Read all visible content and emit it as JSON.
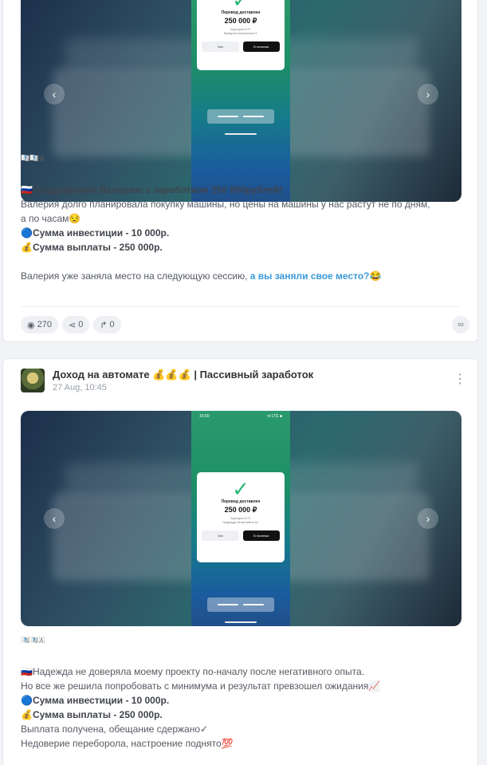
{
  "post1": {
    "flags": "🇦🇦🇦🇦🇦",
    "lines": {
      "l1_prefix": "🇷🇺",
      "l1_bold": "Поздравляем Валерию с заработком 250 000рублей!",
      "l2": "Валерия долго планировала покупку машины, но цены на машины у нас растут не по дням,",
      "l3": "а по часам😒",
      "l4": "🔵Сумма инвестиции - 10 000р.",
      "l5": "💰Сумма выплаты - 250 000р.",
      "l6_text": "Валерия уже заняла место на следующую сессию, ",
      "l6_link": "а вы заняли свое место?😂"
    },
    "receipt": {
      "title": "Перевод доставлен",
      "amount": "250 000 ₽",
      "sub1": "Кукоорин Е.Р.",
      "sub2": "Валерия Алексеева Н.",
      "btn_check": "Чек",
      "btn_done": "В платежи"
    },
    "stats": {
      "views": "270",
      "shares": "0",
      "forwards": "0"
    }
  },
  "post2": {
    "channel_name": "Доход на автомате 💰💰💰 | Пассивный заработок",
    "date": "27 Aug, 10:45",
    "flags": "🇦🇦🇦🇦🇦",
    "phone_time": "15:00",
    "phone_signal": "•ıl LTE ■",
    "receipt": {
      "title": "Перевод доставлен",
      "amount": "250 000 ₽",
      "sub1": "Кукоорин Е.Р.",
      "sub2": "Надежда Игнатьевна Ш.",
      "btn_check": "Чек",
      "btn_done": "В платежи"
    },
    "lines": {
      "l1_prefix": "🇷🇺",
      "l1": "Надежда не доверяла моему проекту по-началу после негативного опыта.",
      "l2": "Но все же решила попробовать с минимума и результат превзошел ожидания📈",
      "l3": "🔵Сумма инвестиции - 10 000р.",
      "l4": "💰Сумма выплаты - 250 000р.",
      "l5": "Выплата получена, обещание сдержано✓",
      "l6": "Недоверие переборола, настроение поднято💯"
    }
  },
  "icons": {
    "views": "eye-icon",
    "shares": "share-icon",
    "forwards": "forward-icon",
    "link": "link-icon",
    "menu": "more-vertical-icon",
    "prev": "chevron-left-icon",
    "next": "chevron-right-icon"
  },
  "colors": {
    "accent_link": "#3a9ad9",
    "receipt_check": "#2bb673"
  }
}
